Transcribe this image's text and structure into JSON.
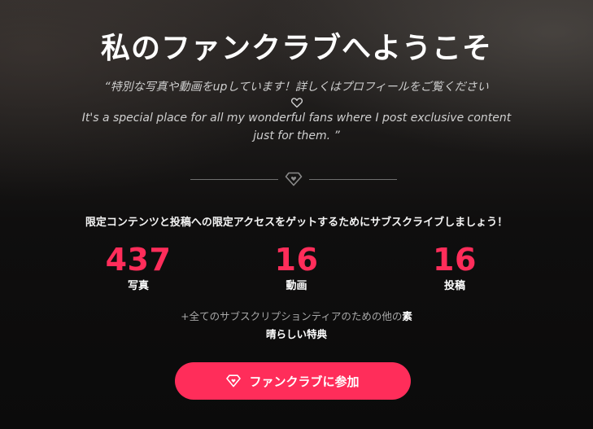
{
  "header": {
    "title": "私のファンクラブへようこそ"
  },
  "quote": {
    "line1": "“特別な写真や動画をupしています！詳しくはプロフィールをご覧ください",
    "line2": "It's a special place for all my wonderful fans where I post exclusive content just for them. ”"
  },
  "subtitle": "限定コンテンツと投稿への限定アクセスをゲットするためにサブスクライブしましょう！",
  "stats": [
    {
      "value": "437",
      "label": "写真"
    },
    {
      "value": "16",
      "label": "動画"
    },
    {
      "value": "16",
      "label": "投稿"
    }
  ],
  "perks": {
    "prefix": "+全てのサブスクリプションティアのための他の",
    "highlight": "素晴らしい特典"
  },
  "join_button": {
    "label": "ファンクラブに参加",
    "icon": "diamond-heart-icon"
  },
  "colors": {
    "accent": "#ff2d5a",
    "muted_text": "#a8a8a8",
    "quote_text": "#cfcfcf"
  }
}
